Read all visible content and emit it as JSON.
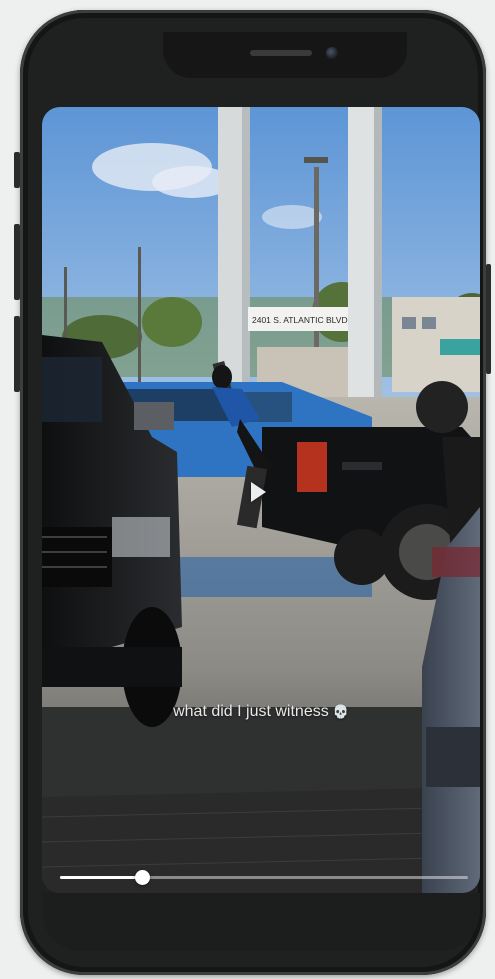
{
  "video": {
    "caption": "what did I just witness",
    "caption_emoji": "💀",
    "sign_text": "2401 S. ATLANTIC BLVD",
    "playback_progress": 0.2
  },
  "icons": {
    "play": "play-icon",
    "skull": "skull-emoji"
  },
  "colors": {
    "phone_frame": "#1f2020",
    "seek_fill": "#ffffff",
    "background": "#eef0ef"
  }
}
